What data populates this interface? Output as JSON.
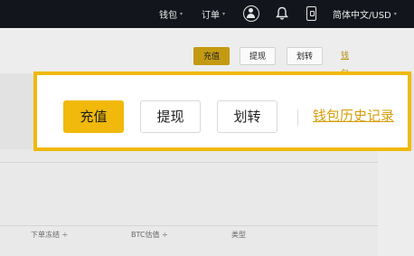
{
  "topbar": {
    "wallet_label": "钱包",
    "orders_label": "订单",
    "language_currency_label": "简体中文/USD",
    "caret": "▾"
  },
  "actions_small": {
    "deposit": "充值",
    "withdraw": "提现",
    "transfer": "划转",
    "history": "钱包历史记录"
  },
  "actions_highlight": {
    "deposit": "充值",
    "withdraw": "提现",
    "transfer": "划转",
    "history": "钱包历史记录"
  },
  "table": {
    "columns": [
      "下单冻结 ÷",
      "BTC估值 ÷",
      "类型"
    ]
  },
  "colors": {
    "brand_yellow": "#f0b90b",
    "topbar_bg": "#12161c",
    "link_gold": "#d69f0a"
  },
  "icons": [
    "user-icon",
    "bell-icon",
    "mobile-download-icon"
  ]
}
